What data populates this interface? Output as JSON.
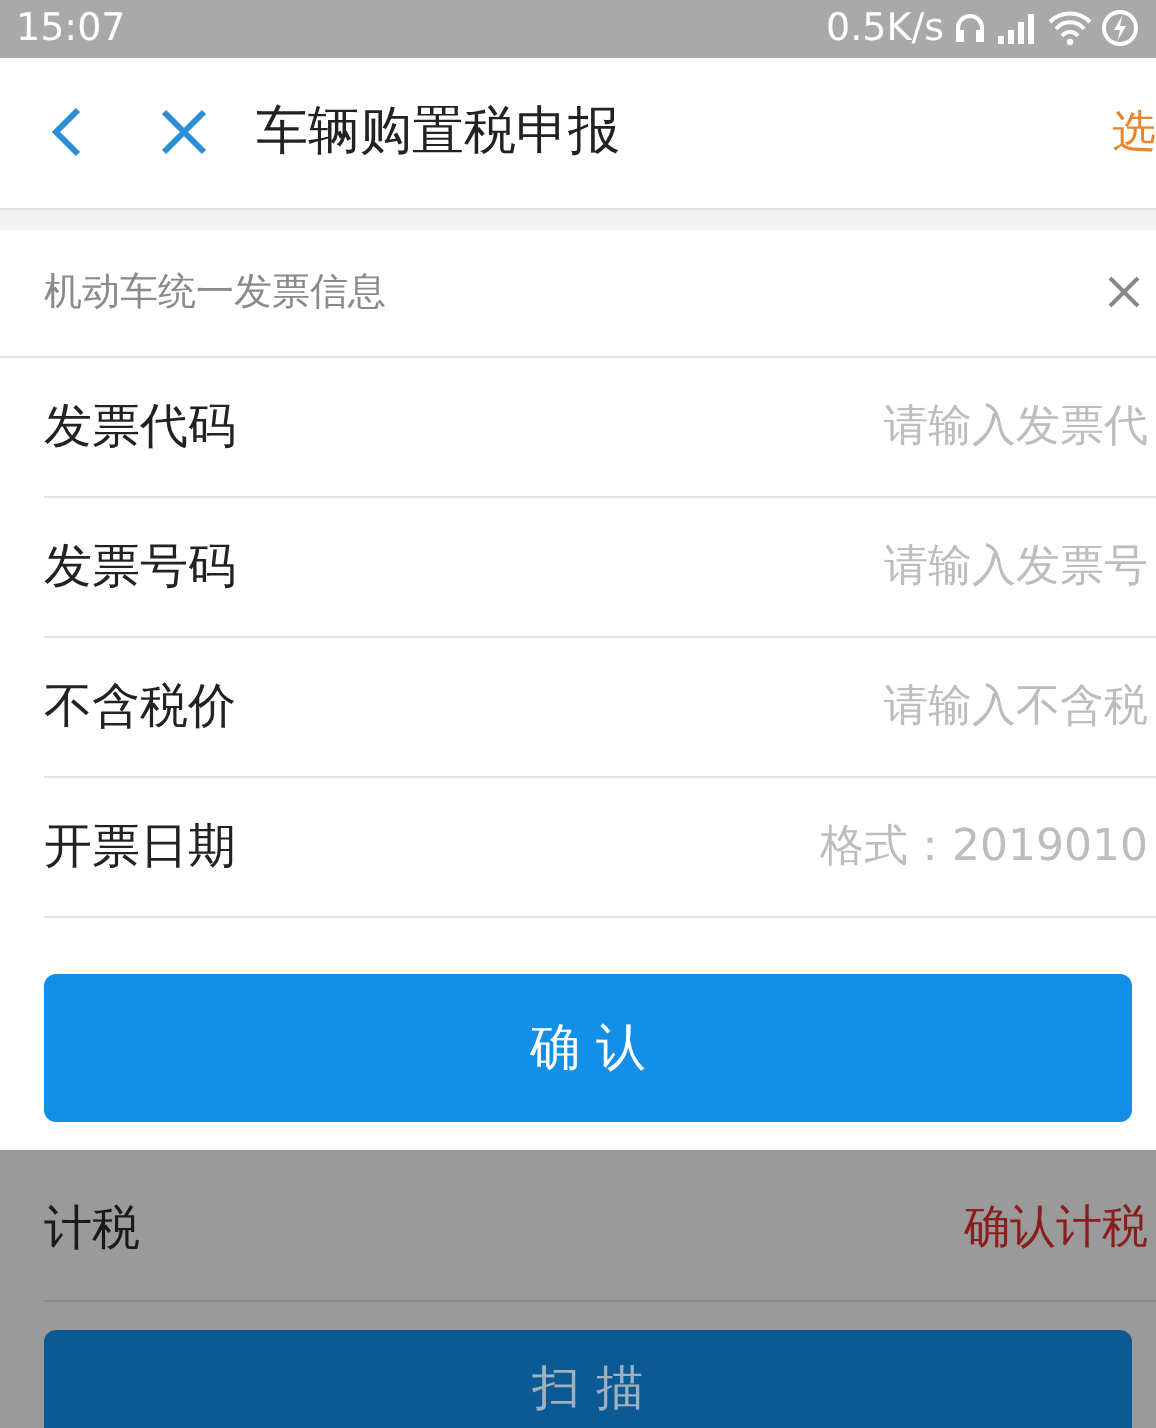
{
  "status_bar": {
    "time": "15:07",
    "speed": "0.5K/s"
  },
  "header": {
    "title": "车辆购置税申报",
    "action": "选"
  },
  "sheet": {
    "title": "机动车统一发票信息",
    "fields": [
      {
        "label": "发票代码",
        "placeholder": "请输入发票代"
      },
      {
        "label": "发票号码",
        "placeholder": "请输入发票号"
      },
      {
        "label": "不含税价",
        "placeholder": "请输入不含税"
      },
      {
        "label": "开票日期",
        "placeholder": "格式：2019010"
      }
    ],
    "confirm": "确 认"
  },
  "background": {
    "row_label": "计税",
    "row_value": "确认计税",
    "scan": "扫 描"
  }
}
